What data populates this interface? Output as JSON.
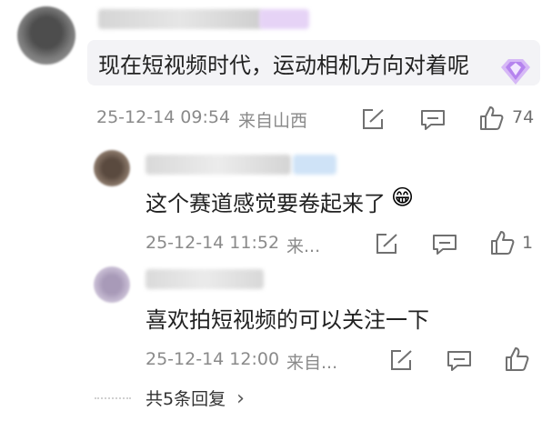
{
  "comments": [
    {
      "text": "现在短视频时代，运动相机方向对着呢",
      "time": "25-12-14 09:54",
      "location": "来自山西",
      "likes": "74"
    },
    {
      "text": "这个赛道感觉要卷起来了",
      "emoji": "😁",
      "time": "25-12-14 11:52",
      "location": "来..."
    },
    {
      "text": "喜欢拍短视频的可以关注一下",
      "time": "25-12-14 12:00",
      "location": "来自..."
    }
  ],
  "replies_link": "共5条回复",
  "replies_chevron": "›",
  "likes_reply1": "1"
}
